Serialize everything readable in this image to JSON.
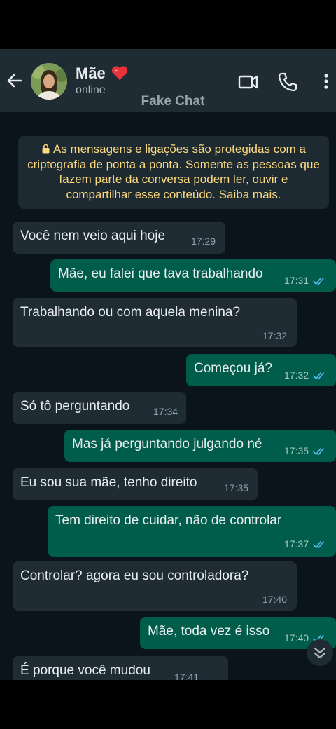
{
  "header": {
    "contact_name": "Mãe",
    "status": "online",
    "icons": [
      "back-arrow-icon",
      "video-call-icon",
      "phone-call-icon",
      "more-options-icon"
    ]
  },
  "watermark": "Fake Chat",
  "encryption_notice": "As mensagens e ligações são protegidas com a criptografia de ponta a ponta. Somente as pessoas que fazem parte da conversa podem ler, ouvir e compartilhar esse conteúdo. Saiba mais.",
  "messages": [
    {
      "dir": "in",
      "text": "Você nem veio aqui hoje",
      "time": "17:29"
    },
    {
      "dir": "out",
      "text": "Mãe, eu falei que tava trabalhando",
      "time": "17:31",
      "read": true
    },
    {
      "dir": "in",
      "text": "Trabalhando ou com aquela menina?",
      "time": "17:32"
    },
    {
      "dir": "out",
      "text": "Começou já?",
      "time": "17:32",
      "read": true
    },
    {
      "dir": "in",
      "text": "Só tô perguntando",
      "time": "17:34"
    },
    {
      "dir": "out",
      "text": "Mas já perguntando julgando né",
      "time": "17:35",
      "read": true
    },
    {
      "dir": "in",
      "text": "Eu sou sua mãe, tenho direito",
      "time": "17:35"
    },
    {
      "dir": "out",
      "text": "Tem direito de cuidar, não de controlar",
      "time": "17:37",
      "read": true
    },
    {
      "dir": "in",
      "text": "Controlar? agora eu sou controladora?",
      "time": "17:40"
    },
    {
      "dir": "out",
      "text": "Mãe, toda vez é isso",
      "time": "17:40",
      "read": true
    },
    {
      "dir": "in",
      "text": "É porque você mudou",
      "time": "17:41"
    }
  ],
  "colors": {
    "background": "#0b141a",
    "header": "#1f2c34",
    "incoming_bubble": "#1f2c34",
    "outgoing_bubble": "#005c4b",
    "read_ticks": "#53bdeb",
    "notice_text": "#fcd97f"
  }
}
